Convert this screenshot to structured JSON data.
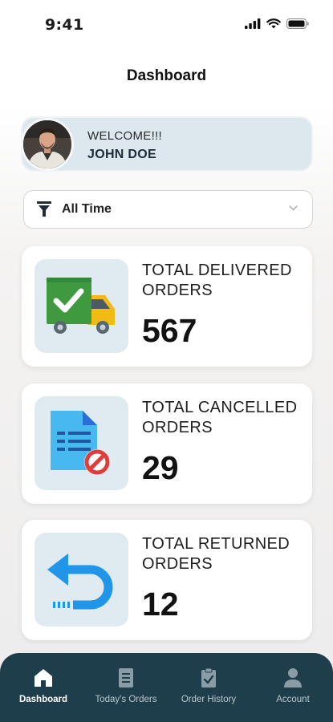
{
  "status_bar": {
    "time": "9:41"
  },
  "header": {
    "title": "Dashboard"
  },
  "welcome": {
    "greeting": "WELCOME!!!",
    "name": "JOHN DOE"
  },
  "filter": {
    "selected": "All Time"
  },
  "stats": [
    {
      "label": "TOTAL DELIVERED ORDERS",
      "value": "567",
      "icon": "delivery-truck-icon"
    },
    {
      "label": "TOTAL CANCELLED ORDERS",
      "value": "29",
      "icon": "cancelled-document-icon"
    },
    {
      "label": "TOTAL RETURNED ORDERS",
      "value": "12",
      "icon": "return-arrow-icon"
    }
  ],
  "nav": {
    "items": [
      {
        "label": "Dashboard",
        "icon": "home-icon",
        "active": true
      },
      {
        "label": "Today's Orders",
        "icon": "orders-list-icon",
        "active": false
      },
      {
        "label": "Order History",
        "icon": "clipboard-check-icon",
        "active": false
      },
      {
        "label": "Account",
        "icon": "user-icon",
        "active": false
      }
    ]
  },
  "colors": {
    "nav_background": "#1f3e4c",
    "welcome_background": "#dde8ee",
    "icon_box_background": "#e0ebf1"
  }
}
